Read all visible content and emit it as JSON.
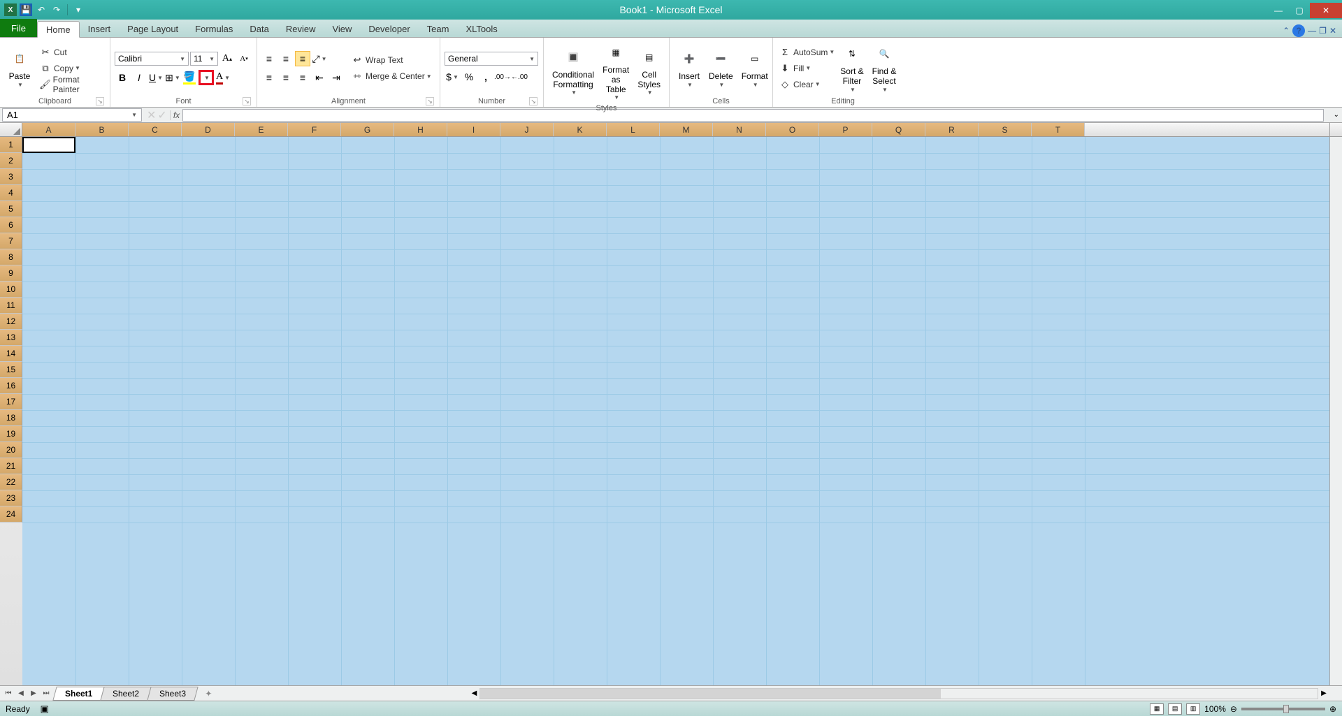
{
  "title": "Book1 - Microsoft Excel",
  "qat": {
    "undo": "↶",
    "redo": "↷"
  },
  "tabs": {
    "file": "File",
    "items": [
      "Home",
      "Insert",
      "Page Layout",
      "Formulas",
      "Data",
      "Review",
      "View",
      "Developer",
      "Team",
      "XLTools"
    ],
    "active": "Home"
  },
  "ribbon": {
    "clipboard": {
      "label": "Clipboard",
      "paste": "Paste",
      "cut": "Cut",
      "copy": "Copy",
      "format_painter": "Format Painter"
    },
    "font": {
      "label": "Font",
      "name": "Calibri",
      "size": "11"
    },
    "alignment": {
      "label": "Alignment",
      "wrap": "Wrap Text",
      "merge": "Merge & Center"
    },
    "number": {
      "label": "Number",
      "format": "General"
    },
    "styles": {
      "label": "Styles",
      "cond": "Conditional\nFormatting",
      "table": "Format\nas Table",
      "cell": "Cell\nStyles"
    },
    "cells": {
      "label": "Cells",
      "insert": "Insert",
      "delete": "Delete",
      "format": "Format"
    },
    "editing": {
      "label": "Editing",
      "autosum": "AutoSum",
      "fill": "Fill",
      "clear": "Clear",
      "sort": "Sort &\nFilter",
      "find": "Find &\nSelect"
    }
  },
  "namebox": "A1",
  "columns": [
    "A",
    "B",
    "C",
    "D",
    "E",
    "F",
    "G",
    "H",
    "I",
    "J",
    "K",
    "L",
    "M",
    "N",
    "O",
    "P",
    "Q",
    "R",
    "S",
    "T"
  ],
  "rows": [
    "1",
    "2",
    "3",
    "4",
    "5",
    "6",
    "7",
    "8",
    "9",
    "10",
    "11",
    "12",
    "13",
    "14",
    "15",
    "16",
    "17",
    "18",
    "19",
    "20",
    "21",
    "22",
    "23",
    "24"
  ],
  "sheets": {
    "items": [
      "Sheet1",
      "Sheet2",
      "Sheet3"
    ],
    "active": "Sheet1"
  },
  "status": {
    "ready": "Ready",
    "zoom": "100%"
  }
}
